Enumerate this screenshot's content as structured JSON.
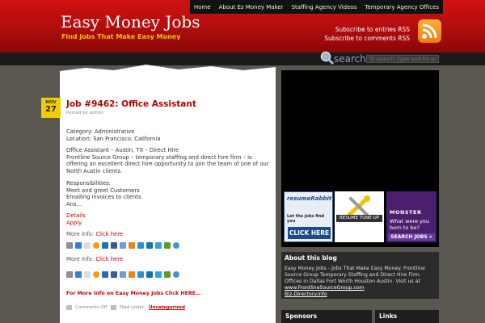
{
  "header": {
    "site_title": "Easy Money Jobs",
    "tagline": "Find Jobs That Make Easy Money",
    "nav": [
      "Home",
      "About Ez Money Maker",
      "Staffing Agency Videos",
      "Temporary Agency Offices"
    ],
    "rss_entries": "Subscribe to entries RSS",
    "rss_comments": "Subscribe to comments RSS"
  },
  "search": {
    "label": "search",
    "placeholder": "To search, type and hit enter"
  },
  "post": {
    "month": "NOV",
    "day": "27",
    "title": "Job #9462: Office Assistant",
    "posted_by": "Posted by admin",
    "category": "Category: Administrative",
    "location": "Location: San Francisco, California",
    "line1": "Office Assistant – Austin, TX – Direct Hire",
    "line2": "Frontline Source Group – temporary staffing and direct hire firm – is offering an excellent direct hire opportunity to join the team of one of our North Austin clients.",
    "resp_title": "Responsibilities:",
    "resp1": "Meet and greet Customers",
    "resp2": "Emailing invoices to clients",
    "ans": "Ans…",
    "details": "Details",
    "apply": "Apply",
    "more_info_label": "More Info:",
    "click_here": "Click here",
    "footer_link": "For More Info on Easy Money Jobs Click HERE…",
    "comments": "Comments Off",
    "filed_under": "Filed under:",
    "category_link": "Uncategorized"
  },
  "ads": {
    "resume_logo": "resumeRabbit",
    "resume_tag": "Let the jobs find you",
    "resume_btn": "CLICK HERE",
    "tuneup": "RESUME TUNE-UP",
    "monster_logo": "MONSTER",
    "monster_q": "What were you born to be?",
    "monster_btn": "SEARCH JOBS »"
  },
  "about": {
    "title": "About this blog",
    "text": "Easy Money Jobs - Jobs That Make Easy Money. Frontline Source Group Temporary Staffing and Direct Hire Firm. Offices in Dallas Fort Worth Houston Austin. Visit us at",
    "link1": "www.FrontlineSourceGroup.com",
    "link2": "Biz-Directory.info"
  },
  "sidebar": {
    "sponsors": "Sponsors",
    "links": "Links"
  },
  "colors": {
    "header_red": "#c00e0e",
    "tagline_yellow": "#f6c400",
    "link_red": "#c80000",
    "badge_yellow": "#f1cc00"
  }
}
